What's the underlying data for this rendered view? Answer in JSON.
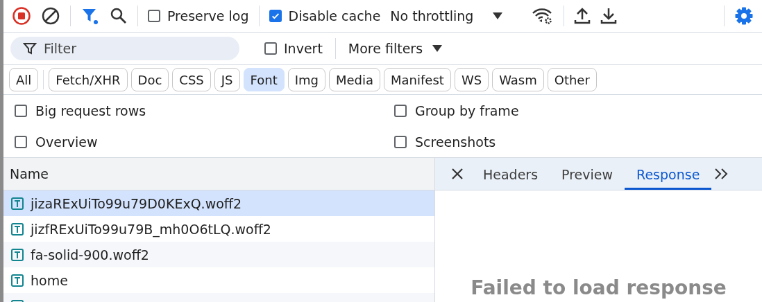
{
  "toolbar": {
    "recording": true,
    "preserve_log": {
      "label": "Preserve log",
      "checked": false
    },
    "disable_cache": {
      "label": "Disable cache",
      "checked": true
    },
    "throttling": "No throttling"
  },
  "filter_bar": {
    "placeholder": "Filter",
    "invert": {
      "label": "Invert",
      "checked": false
    },
    "more_filters": "More filters"
  },
  "types": [
    {
      "label": "All",
      "selected": false
    },
    {
      "label": "Fetch/XHR",
      "selected": false
    },
    {
      "label": "Doc",
      "selected": false
    },
    {
      "label": "CSS",
      "selected": false
    },
    {
      "label": "JS",
      "selected": false
    },
    {
      "label": "Font",
      "selected": true
    },
    {
      "label": "Img",
      "selected": false
    },
    {
      "label": "Media",
      "selected": false
    },
    {
      "label": "Manifest",
      "selected": false
    },
    {
      "label": "WS",
      "selected": false
    },
    {
      "label": "Wasm",
      "selected": false
    },
    {
      "label": "Other",
      "selected": false
    }
  ],
  "options": [
    {
      "label": "Big request rows",
      "checked": false
    },
    {
      "label": "Group by frame",
      "checked": false
    },
    {
      "label": "Overview",
      "checked": false
    },
    {
      "label": "Screenshots",
      "checked": false
    }
  ],
  "requests": {
    "column": "Name",
    "rows": [
      {
        "name": "jizaRExUiTo99u79D0KExQ.woff2",
        "selected": true
      },
      {
        "name": "jizfRExUiTo99u79B_mh0O6tLQ.woff2",
        "selected": false
      },
      {
        "name": "fa-solid-900.woff2",
        "selected": false
      },
      {
        "name": "home",
        "selected": false
      }
    ]
  },
  "details": {
    "tabs": [
      {
        "label": "Headers",
        "selected": false
      },
      {
        "label": "Preview",
        "selected": false
      },
      {
        "label": "Response",
        "selected": true
      }
    ],
    "message": "Failed to load response"
  }
}
